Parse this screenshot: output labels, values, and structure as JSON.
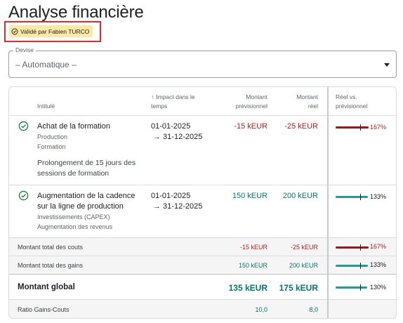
{
  "page": {
    "title": "Analyse financière"
  },
  "validation": {
    "label": "Validé par Fabien TURCO",
    "icon": "check-circle-icon"
  },
  "currency_select": {
    "legend": "Devise",
    "value": "– Automatique –",
    "icon": "dropdown-arrow-icon"
  },
  "table": {
    "headers": {
      "title": "Intitulé",
      "impact_line1": "Impact dans le",
      "impact_line2": "temps",
      "forecast_line1": "Montant",
      "forecast_line2": "prévisionnel",
      "actual_line1": "Montant",
      "actual_line2": "réel",
      "ratio_line1": "Réel vs.",
      "ratio_line2": "prévisionnel",
      "sort_icon": "arrow-up-icon"
    },
    "rows": [
      {
        "title": "Achat de la formation",
        "category": "Production",
        "subcategory": "Formation",
        "description_line1": "Prolongement de 15 jours des",
        "description_line2": "sessions de formation",
        "start": "01-01-2025",
        "end": "→ 31-12-2025",
        "forecast": "-15 kEUR",
        "actual": "-25 kEUR",
        "ratio_pct": 167,
        "ratio_label": "167%",
        "status_icon": "check-circle-icon",
        "color": "#b71c1c"
      },
      {
        "title_line1": "Augmentation de la cadence",
        "title_line2": "sur la ligne de production",
        "category": "Investissements (CAPEX)",
        "subcategory": "Augmentation des revenus",
        "start": "01-01-2025",
        "end": "→ 31-12-2025",
        "forecast": "150 kEUR",
        "actual": "200 kEUR",
        "ratio_pct": 133,
        "ratio_label": "133%",
        "status_icon": "check-circle-icon",
        "color": "#00796b"
      }
    ],
    "totals": {
      "costs": {
        "label": "Montant total des couts",
        "forecast": "-15 kEUR",
        "actual": "-25 kEUR",
        "ratio_pct": 167,
        "ratio_label": "167%"
      },
      "gains": {
        "label": "Montant total des gains",
        "forecast": "150 kEUR",
        "actual": "200 kEUR",
        "ratio_pct": 133,
        "ratio_label": "133%"
      },
      "global": {
        "label": "Montant global",
        "forecast": "135 kEUR",
        "actual": "175 kEUR",
        "ratio_pct": 130,
        "ratio_label": "130%"
      },
      "ratio": {
        "label": "Ratio Gains-Couts",
        "forecast": "10,0",
        "actual": "8,0"
      }
    }
  },
  "colors": {
    "cost": "#b71c1c",
    "gain": "#00796b",
    "validated_chip": "#fce9a6",
    "highlight_border": "#d32f2f"
  }
}
